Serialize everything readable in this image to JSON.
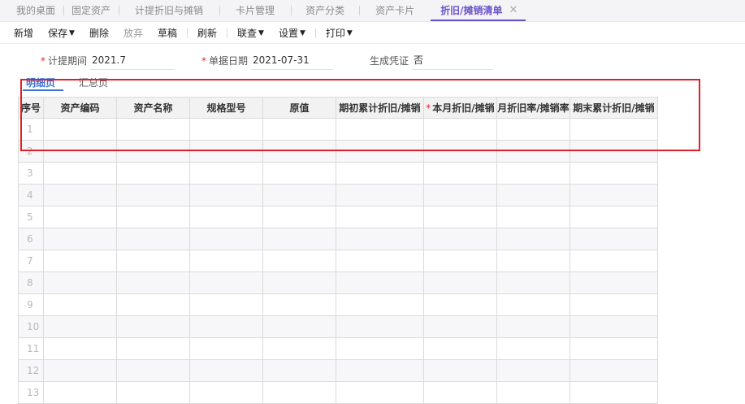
{
  "tabs": [
    {
      "label": "我的桌面",
      "active": false
    },
    {
      "label": "固定资产",
      "active": false
    },
    {
      "label": "计提折旧与摊销",
      "active": false
    },
    {
      "label": "卡片管理",
      "active": false
    },
    {
      "label": "资产分类",
      "active": false
    },
    {
      "label": "资产卡片",
      "active": false
    },
    {
      "label": "折旧/摊销清单",
      "active": true
    }
  ],
  "tab_close_glyph": "✕",
  "toolbar": {
    "new": "新增",
    "save": "保存",
    "delete": "删除",
    "discard": "放弃",
    "draft": "草稿",
    "refresh": "刷新",
    "link": "联查",
    "settings": "设置",
    "print": "打印"
  },
  "form": {
    "period_label": "计提期间",
    "period_value": "2021.7",
    "date_label": "单据日期",
    "date_value": "2021-07-31",
    "voucher_label": "生成凭证",
    "voucher_value": "否"
  },
  "subtabs": {
    "detail": "明细页",
    "summary": "汇总页"
  },
  "grid": {
    "columns": [
      "序号",
      "资产编码",
      "资产名称",
      "规格型号",
      "原值",
      "期初累计折旧/摊销",
      "本月折旧/摊销",
      "月折旧率/摊销率",
      "期末累计折旧/摊销"
    ],
    "required_column": "本月折旧/摊销",
    "rows": [
      "1",
      "2",
      "3",
      "4",
      "5",
      "6",
      "7",
      "8",
      "9",
      "10",
      "11",
      "12",
      "13"
    ]
  },
  "colors": {
    "active_tab": "#6a52c9",
    "active_subtab": "#3b73d6",
    "highlight_box": "#e01f2b",
    "required_mark": "#e23333"
  }
}
